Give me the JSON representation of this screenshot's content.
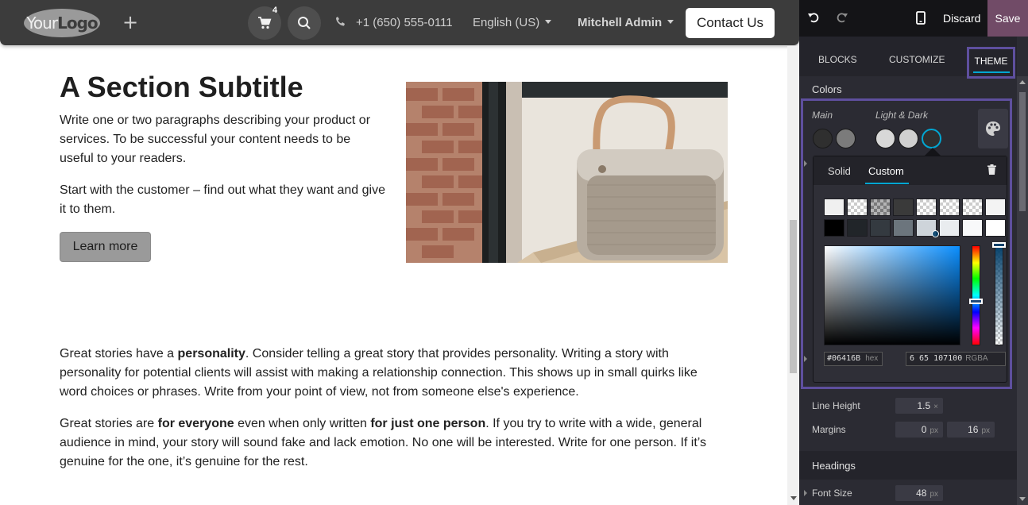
{
  "navbar": {
    "logo_text": "YourLogo",
    "cart_count": "4",
    "phone": "+1 (650) 555-0111",
    "language": "English (US)",
    "user": "Mitchell Admin",
    "contact_label": "Contact Us"
  },
  "content": {
    "section_title": "A Section Subtitle",
    "p1": "Write one or two paragraphs describing your product or services. To be successful your content needs to be useful to your readers.",
    "p2": "Start with the customer – find out what they want and give it to them.",
    "learn_more": "Learn more",
    "p3_a": "Great stories have a ",
    "p3_b": "personality",
    "p3_c": ". Consider telling a great story that provides personality. Writing a story with personality for potential clients will assist with making a relationship connection. This shows up in small quirks like word choices or phrases. Write from your point of view, not from someone else's experience.",
    "p4_a": "Great stories are ",
    "p4_b": "for everyone",
    "p4_c": " even when only written ",
    "p4_d": "for just one person",
    "p4_e": ". If you try to write with a wide, general audience in mind, your story will sound fake and lack emotion. No one will be interested. Write for one person. If it’s genuine for the one, it’s genuine for the rest."
  },
  "editor": {
    "discard": "Discard",
    "save": "Save",
    "tabs": {
      "blocks": "BLOCKS",
      "customize": "CUSTOMIZE",
      "theme": "THEME"
    },
    "colors_label": "Colors",
    "main_label": "Main",
    "light_dark_label": "Light & Dark",
    "main_swatches": [
      "#2f2f2f",
      "#7b7b7b"
    ],
    "ld_swatches": [
      "#d8d8d8",
      "#d0d0d0",
      "#2f2f2f"
    ],
    "picker": {
      "tab_solid": "Solid",
      "tab_custom": "Custom",
      "grid_colors": [
        "#f0f0f0",
        "checker",
        "checker-dark",
        "checker-darker",
        "checker",
        "checker",
        "checker",
        "#f3f3f3",
        "#000000",
        "#212529",
        "#343a40",
        "#6c757d",
        "#ced4da",
        "#e9ecef",
        "#f8f9fa",
        "#ffffff"
      ],
      "hex_value": "#06416B",
      "hex_unit": "hex",
      "rgba_value": "6   65 107100",
      "rgba_unit": "RGBA"
    },
    "line_height_label": "Line Height",
    "line_height_value": "1.5",
    "line_height_unit": "×",
    "margins_label": "Margins",
    "margin_1": "0",
    "margin_2": "16",
    "px_unit": "px",
    "headings_label": "Headings",
    "font_size_label": "Font Size",
    "font_size_value": "48"
  }
}
